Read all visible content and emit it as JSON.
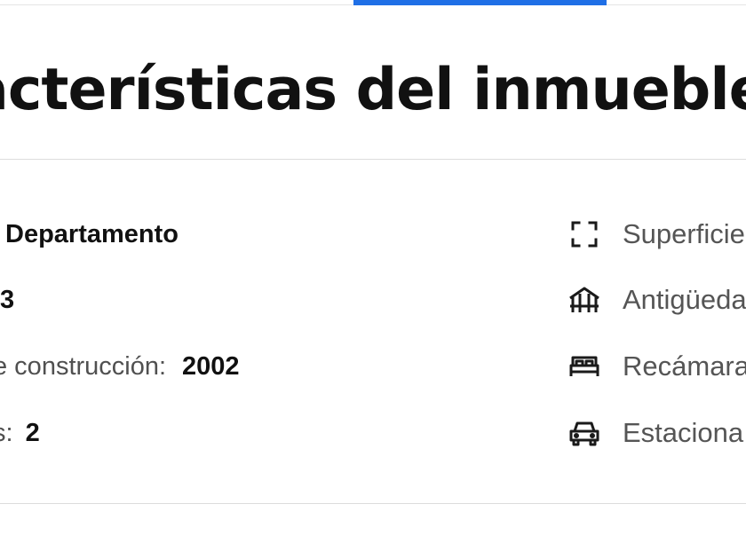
{
  "section": {
    "title": "acterísticas del inmueble"
  },
  "left_features": [
    {
      "label": "",
      "value": "Departamento"
    },
    {
      "label": "",
      "value": "3"
    },
    {
      "label": "e construcción:",
      "value": "2002"
    },
    {
      "label": "s:",
      "value": "2"
    }
  ],
  "right_features": [
    {
      "icon": "area-frame-icon",
      "label": "Superficie"
    },
    {
      "icon": "building-age-icon",
      "label": "Antigüeda"
    },
    {
      "icon": "bed-icon",
      "label": "Recámara"
    },
    {
      "icon": "car-icon",
      "label": "Estaciona"
    }
  ],
  "colors": {
    "accent": "#1f6fe6",
    "text_dark": "#111111",
    "text_muted": "#555555",
    "divider": "#dcdcdc"
  }
}
